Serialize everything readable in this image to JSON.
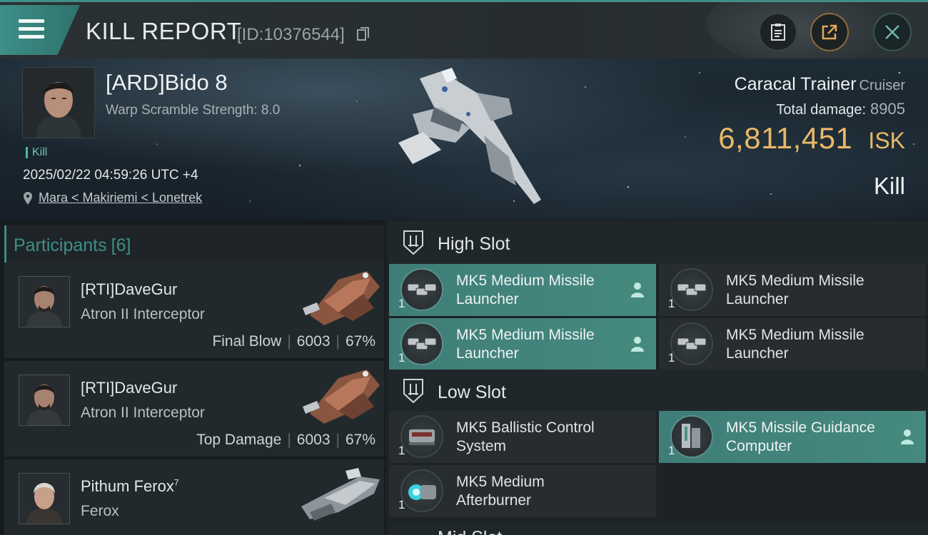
{
  "header": {
    "title": "KILL REPORT",
    "report_id": "[ID:10376544]",
    "icons": [
      "menu-icon",
      "copy-icon",
      "clipboard-icon",
      "share-icon",
      "close-icon"
    ]
  },
  "victim": {
    "name": "[ARD]Bido 8",
    "subtitle": "Warp Scramble Strength: 8.0",
    "tag": "Kill",
    "timestamp": "2025/02/22 04:59:26 UTC +4",
    "location": "Mara < Makiriemi < Lonetrek",
    "ship": "Caracal Trainer",
    "ship_class": "Cruiser",
    "damage_label": "Total damage:",
    "damage_value": "8905",
    "isk_value": "6,811,451",
    "isk_unit": "ISK",
    "result": "Kill"
  },
  "participants": {
    "title": "Participants",
    "count": "[6]",
    "items": [
      {
        "name": "[RTI]DaveGur",
        "sup": "",
        "ship": "Atron II Interceptor",
        "role": "Final Blow",
        "damage": "6003",
        "percent": "67%"
      },
      {
        "name": "[RTI]DaveGur",
        "sup": "",
        "ship": "Atron II Interceptor",
        "role": "Top Damage",
        "damage": "6003",
        "percent": "67%"
      },
      {
        "name": "Pithum Ferox",
        "sup": "7",
        "ship": "Ferox",
        "role": "",
        "damage": "",
        "percent": ""
      }
    ]
  },
  "fitting": {
    "high_slot": {
      "title": "High Slot",
      "items": [
        {
          "name": "MK5 Medium Missile Launcher",
          "qty": "1",
          "status": "person-icon",
          "active": true
        },
        {
          "name": "MK5 Medium Missile Launcher",
          "qty": "1",
          "status": "x-icon",
          "active": false
        },
        {
          "name": "MK5 Medium Missile Launcher",
          "qty": "1",
          "status": "person-icon",
          "active": true
        },
        {
          "name": "MK5 Medium Missile Launcher",
          "qty": "1",
          "status": "x-icon",
          "active": false
        }
      ]
    },
    "low_slot": {
      "title": "Low Slot",
      "items": [
        {
          "name": "MK5 Ballistic Control System",
          "qty": "1",
          "status": "x-icon",
          "active": false
        },
        {
          "name": "MK5 Missile Guidance Computer",
          "qty": "1",
          "status": "person-icon",
          "active": true
        },
        {
          "name": "MK5 Medium Afterburner",
          "qty": "1",
          "status": "x-icon",
          "active": false
        }
      ]
    },
    "next_section_partial": "Mid Slot"
  },
  "colors": {
    "accent_teal": "#3f8f88",
    "isk_gold": "#e9b869",
    "active_slot": "#45897f"
  }
}
